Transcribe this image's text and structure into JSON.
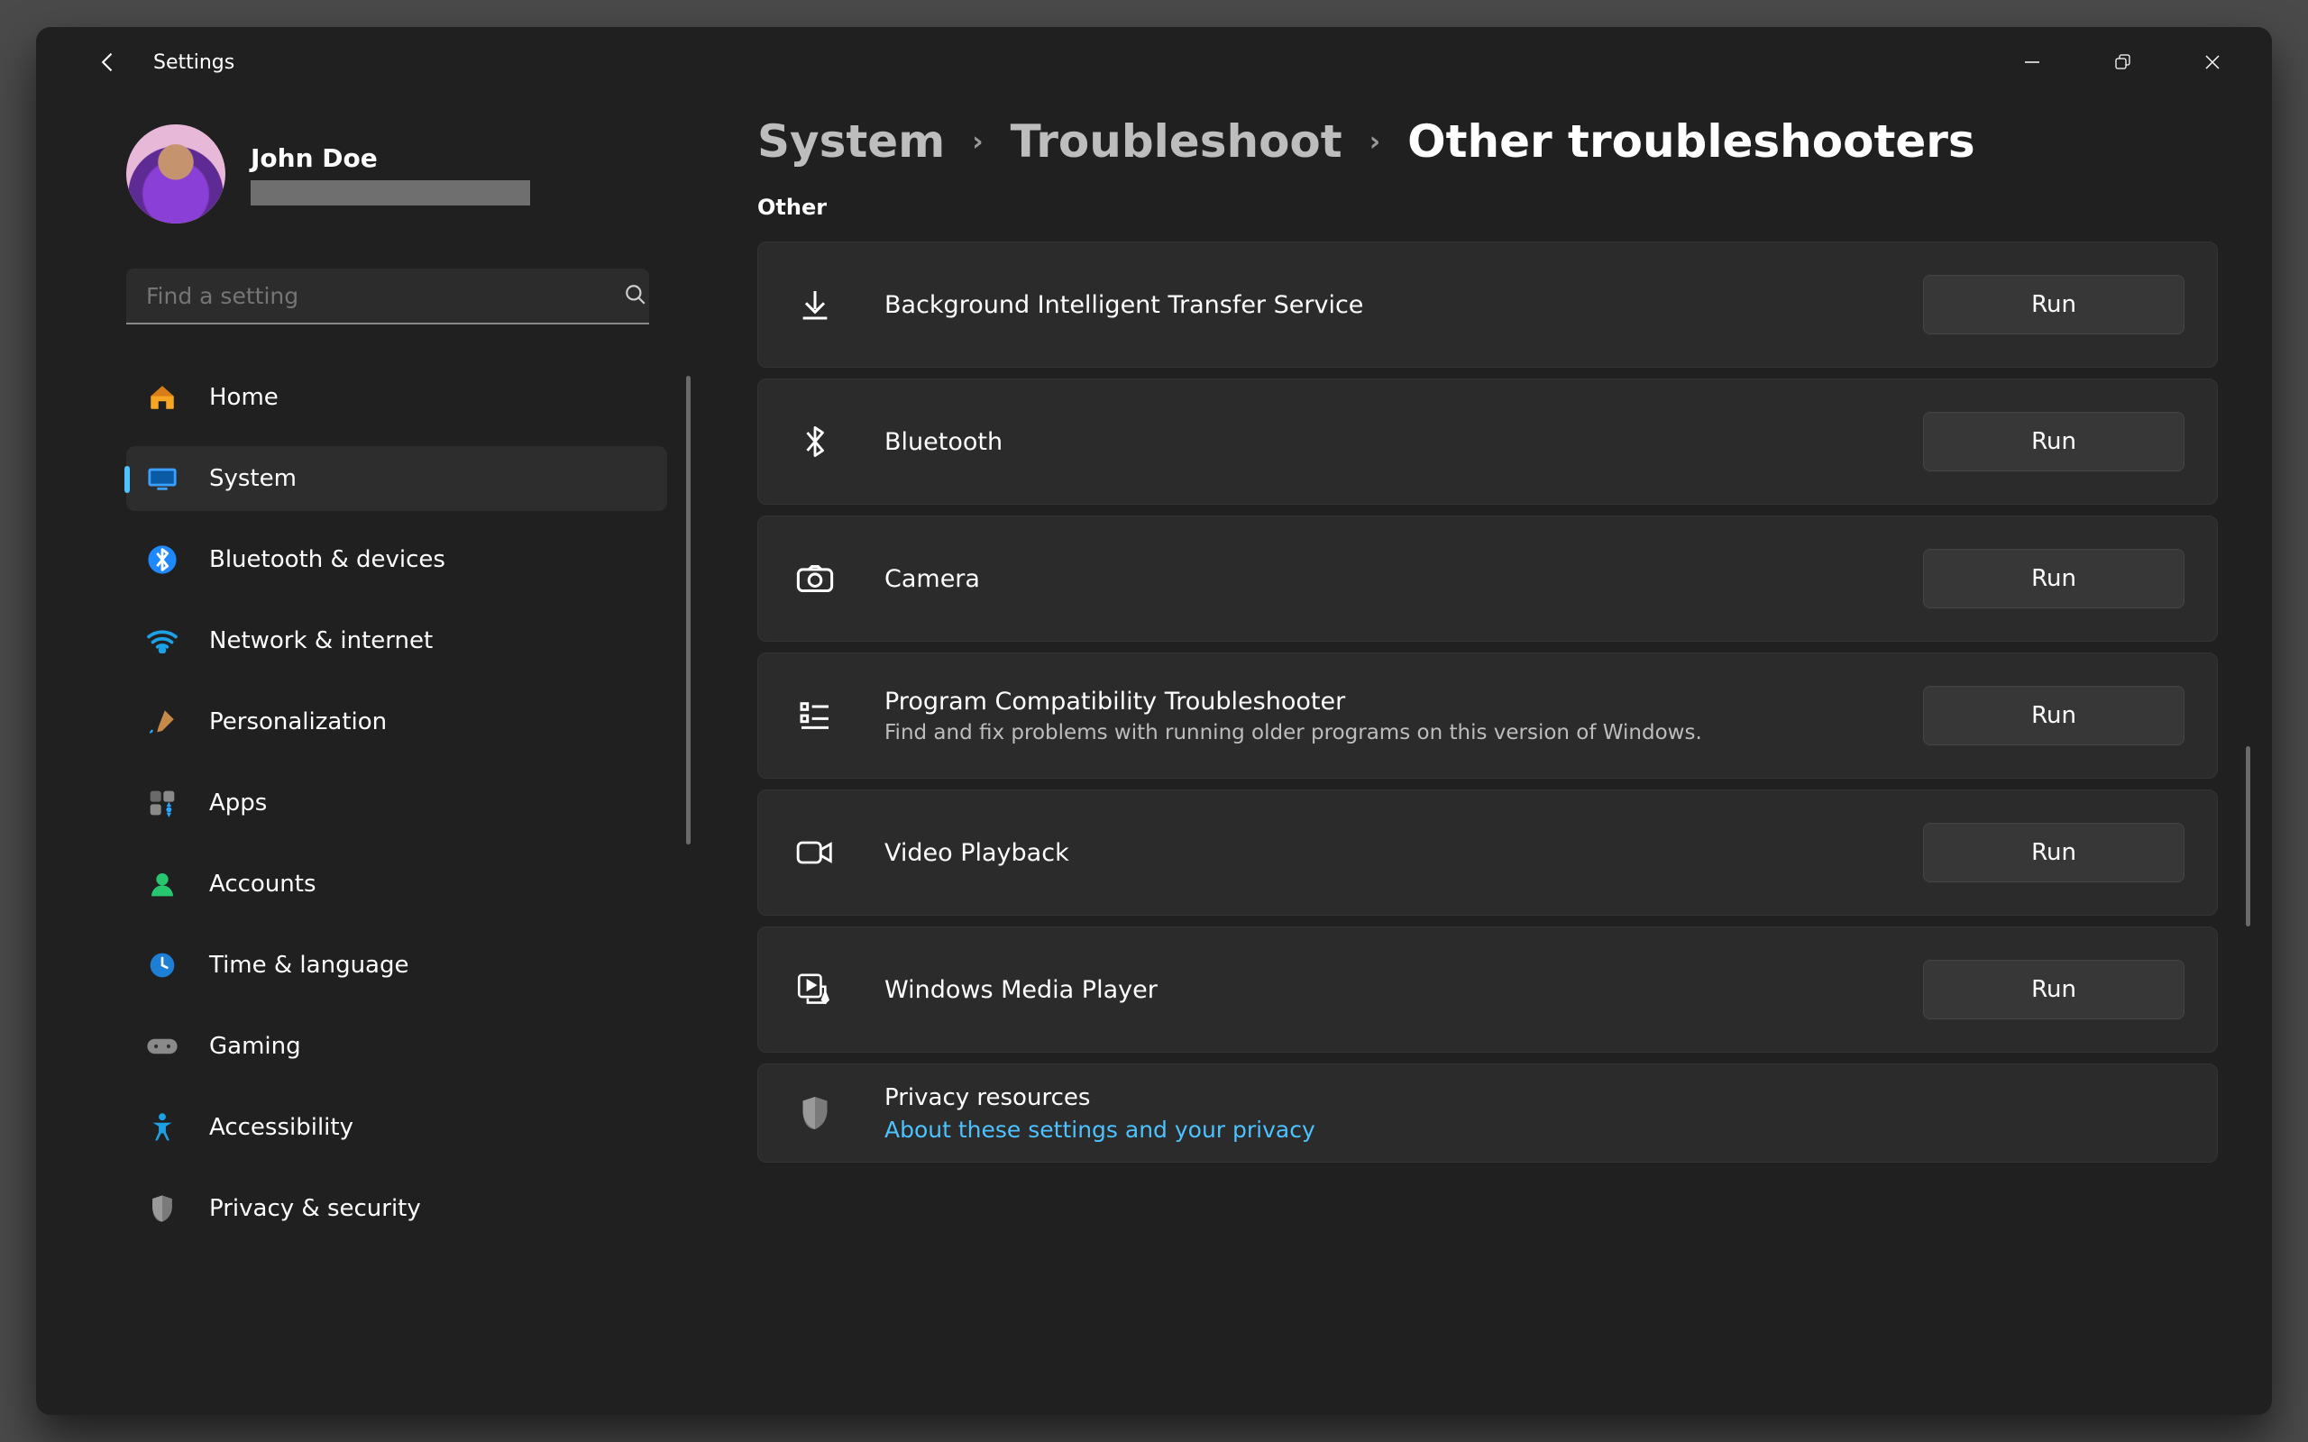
{
  "window": {
    "title": "Settings"
  },
  "profile": {
    "name": "John Doe"
  },
  "search": {
    "placeholder": "Find a setting"
  },
  "sidebar": {
    "items": [
      {
        "label": "Home",
        "icon": "home"
      },
      {
        "label": "System",
        "icon": "system",
        "active": true
      },
      {
        "label": "Bluetooth & devices",
        "icon": "bluetooth"
      },
      {
        "label": "Network & internet",
        "icon": "wifi"
      },
      {
        "label": "Personalization",
        "icon": "brush"
      },
      {
        "label": "Apps",
        "icon": "apps"
      },
      {
        "label": "Accounts",
        "icon": "account"
      },
      {
        "label": "Time & language",
        "icon": "clock"
      },
      {
        "label": "Gaming",
        "icon": "gaming"
      },
      {
        "label": "Accessibility",
        "icon": "accessibility"
      },
      {
        "label": "Privacy & security",
        "icon": "shield"
      }
    ]
  },
  "breadcrumb": {
    "a": "System",
    "b": "Troubleshoot",
    "c": "Other troubleshooters"
  },
  "section": {
    "other": "Other"
  },
  "troubleshooters": [
    {
      "icon": "download",
      "title": "Background Intelligent Transfer Service",
      "run": "Run"
    },
    {
      "icon": "bluetooth",
      "title": "Bluetooth",
      "run": "Run"
    },
    {
      "icon": "camera",
      "title": "Camera",
      "run": "Run"
    },
    {
      "icon": "list",
      "title": "Program Compatibility Troubleshooter",
      "sub": "Find and fix problems with running older programs on this version of Windows.",
      "run": "Run"
    },
    {
      "icon": "video",
      "title": "Video Playback",
      "run": "Run"
    },
    {
      "icon": "media",
      "title": "Windows Media Player",
      "run": "Run"
    }
  ],
  "privacy": {
    "title": "Privacy resources",
    "link": "About these settings and your privacy"
  }
}
